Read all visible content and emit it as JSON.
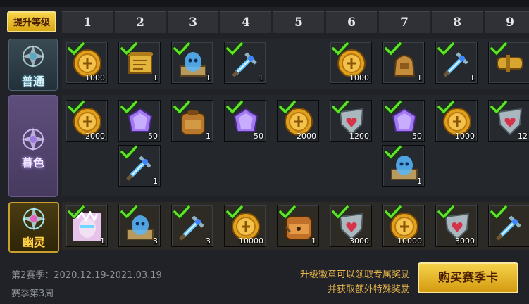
{
  "header": {
    "upgrade_label": "提升等级",
    "columns": [
      "1",
      "2",
      "3",
      "4",
      "5",
      "6",
      "7",
      "8",
      "9"
    ]
  },
  "ranks": [
    {
      "label": "普通",
      "key": "normal"
    },
    {
      "label": "暮色",
      "key": "twilight"
    },
    {
      "label": "幽灵",
      "key": "ghost"
    }
  ],
  "rows": {
    "normal": [
      {
        "col": 1,
        "items": [
          {
            "icon": "gold-coin-icon",
            "qty": "1000"
          }
        ]
      },
      {
        "col": 2,
        "items": [
          {
            "icon": "scroll-icon",
            "qty": "1"
          }
        ]
      },
      {
        "col": 3,
        "items": [
          {
            "icon": "blue-spirit-map-icon",
            "qty": "1"
          }
        ]
      },
      {
        "col": 4,
        "items": [
          {
            "icon": "crystal-sword-icon",
            "qty": "1"
          }
        ]
      },
      {
        "col": 5,
        "items": []
      },
      {
        "col": 6,
        "items": [
          {
            "icon": "gold-coin-icon",
            "qty": "1000"
          }
        ]
      },
      {
        "col": 7,
        "items": [
          {
            "icon": "small-bag-icon",
            "qty": "1"
          }
        ]
      },
      {
        "col": 8,
        "items": [
          {
            "icon": "crystal-sword-icon",
            "qty": "1"
          }
        ]
      },
      {
        "col": 9,
        "items": [
          {
            "icon": "gold-scroll-icon",
            "qty": ""
          }
        ]
      }
    ],
    "twilight": [
      {
        "col": 1,
        "items": [
          {
            "icon": "gold-coin-icon",
            "qty": "2000"
          }
        ]
      },
      {
        "col": 2,
        "items": [
          {
            "icon": "purple-gem-icon",
            "qty": "50"
          },
          {
            "icon": "crystal-sword-icon",
            "qty": "1"
          }
        ]
      },
      {
        "col": 3,
        "items": [
          {
            "icon": "backpack-icon",
            "qty": "1"
          }
        ]
      },
      {
        "col": 4,
        "items": [
          {
            "icon": "purple-gem-icon",
            "qty": "50"
          }
        ]
      },
      {
        "col": 5,
        "items": [
          {
            "icon": "gold-coin-icon",
            "qty": "2000"
          }
        ]
      },
      {
        "col": 6,
        "items": [
          {
            "icon": "heart-shield-icon",
            "qty": "1200"
          }
        ]
      },
      {
        "col": 7,
        "items": [
          {
            "icon": "purple-gem-icon",
            "qty": "50"
          },
          {
            "icon": "blue-spirit-map-icon",
            "qty": "1"
          }
        ]
      },
      {
        "col": 8,
        "items": [
          {
            "icon": "gold-coin-icon",
            "qty": "1000"
          }
        ]
      },
      {
        "col": 9,
        "items": [
          {
            "icon": "heart-shield-icon",
            "qty": "12"
          }
        ]
      }
    ],
    "ghost": [
      {
        "col": 1,
        "items": [
          {
            "icon": "hero-portrait-icon",
            "qty": "1"
          }
        ]
      },
      {
        "col": 2,
        "items": [
          {
            "icon": "blue-spirit-map-icon",
            "qty": "3"
          }
        ]
      },
      {
        "col": 3,
        "items": [
          {
            "icon": "crystal-sword-icon",
            "qty": "3"
          }
        ]
      },
      {
        "col": 4,
        "items": [
          {
            "icon": "gold-coin-icon",
            "qty": "10000"
          }
        ]
      },
      {
        "col": 5,
        "items": [
          {
            "icon": "large-backpack-icon",
            "qty": "1"
          }
        ]
      },
      {
        "col": 6,
        "items": [
          {
            "icon": "heart-shield-icon",
            "qty": "3000"
          }
        ]
      },
      {
        "col": 7,
        "items": [
          {
            "icon": "gold-coin-icon",
            "qty": "10000"
          }
        ]
      },
      {
        "col": 8,
        "items": [
          {
            "icon": "heart-shield-icon",
            "qty": "3000"
          }
        ]
      },
      {
        "col": 9,
        "items": [
          {
            "icon": "crystal-sword-icon",
            "qty": ""
          }
        ]
      }
    ]
  },
  "footer": {
    "season": "第2赛季：2020.12.19-2021.03.19",
    "week": "赛季第3周",
    "hint_line1": "升级徽章可以领取专属奖励",
    "hint_line2": "并获取额外特殊奖励",
    "buy_label": "购买赛季卡"
  },
  "colors": {
    "accent_gold": "#f0c53a",
    "check_green": "#4cd21e",
    "twilight_purple": "#5b4a78",
    "ghost_gold": "#c9a02e"
  }
}
